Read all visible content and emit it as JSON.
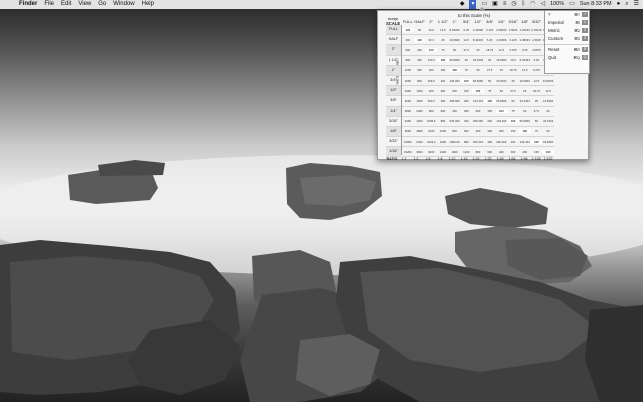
{
  "menubar": {
    "apple": "",
    "items": [
      "Finder",
      "File",
      "Edit",
      "View",
      "Go",
      "Window",
      "Help"
    ],
    "battery": "100%",
    "clock": "Sun 8:33 PM"
  },
  "popover": {
    "title": "to this Scale (%)",
    "scale_small": "change",
    "scale_label": "SCALE",
    "y_axis_label": "from this Scale",
    "columns": [
      "FULL",
      "HALF",
      "2\"",
      "1 1/2\"",
      "1\"",
      "3/4\"",
      "1/2\"",
      "3/8\"",
      "1/4\"",
      "3/16\"",
      "1/8\"",
      "3/32\"",
      "1/16\""
    ],
    "rows": [
      {
        "label": "FULL",
        "cells": [
          "100",
          "50",
          "16.6",
          "12.5",
          "8.33333",
          "6.25",
          "4.16666",
          "3.125",
          "2.08333",
          "1.5625",
          "1.04166",
          "0.78125",
          "0.52083"
        ]
      },
      {
        "label": "HALF",
        "cells": [
          "200",
          "100",
          "33.3",
          "25",
          "16.6666",
          "12.5",
          "8.33333",
          "6.25",
          "4.16666",
          "3.125",
          "2.08333",
          "1.5625",
          "1.04166"
        ]
      },
      {
        "label": "2\"",
        "cells": [
          "600",
          "300",
          "100",
          "75",
          "50",
          "37.5",
          "25",
          "18.75",
          "12.5",
          "9.375",
          "6.25",
          "4.6875",
          "3.125"
        ]
      },
      {
        "label": "1 1/2\"",
        "cells": [
          "800",
          "400",
          "133.3",
          "100",
          "66.6666",
          "50",
          "33.3333",
          "25",
          "16.6666",
          "12.5",
          "8.33333",
          "6.25",
          "4.16666"
        ]
      },
      {
        "label": "1\"",
        "cells": [
          "1200",
          "600",
          "200",
          "150",
          "100",
          "75",
          "50",
          "37.5",
          "25",
          "18.75",
          "12.5",
          "9.375",
          "6.25"
        ]
      },
      {
        "label": "3/4\"",
        "cells": [
          "1600",
          "800",
          "266.6",
          "200",
          "133.333",
          "100",
          "66.6666",
          "50",
          "33.3333",
          "25",
          "16.6666",
          "12.5",
          "8.33333"
        ]
      },
      {
        "label": "1/2\"",
        "cells": [
          "2400",
          "1200",
          "400",
          "300",
          "200",
          "150",
          "100",
          "75",
          "50",
          "37.5",
          "25",
          "18.75",
          "12.5"
        ]
      },
      {
        "label": "3/8\"",
        "cells": [
          "3200",
          "1600",
          "533.3",
          "400",
          "266.666",
          "200",
          "133.333",
          "100",
          "66.6666",
          "50",
          "33.3333",
          "25",
          "16.6666"
        ]
      },
      {
        "label": "1/4\"",
        "cells": [
          "4800",
          "2400",
          "800",
          "600",
          "400",
          "300",
          "200",
          "150",
          "100",
          "75",
          "50",
          "37.5",
          "25"
        ]
      },
      {
        "label": "3/16\"",
        "cells": [
          "6400",
          "3200",
          "1066.6",
          "800",
          "533.333",
          "400",
          "266.666",
          "200",
          "133.333",
          "100",
          "66.6666",
          "50",
          "33.3333"
        ]
      },
      {
        "label": "1/8\"",
        "cells": [
          "9600",
          "4800",
          "1600",
          "1200",
          "800",
          "600",
          "400",
          "300",
          "200",
          "150",
          "100",
          "75",
          "50"
        ]
      },
      {
        "label": "3/32\"",
        "cells": [
          "12800",
          "6400",
          "2133.3",
          "1600",
          "1066.66",
          "800",
          "533.333",
          "400",
          "266.666",
          "200",
          "133.333",
          "100",
          "66.6666"
        ]
      },
      {
        "label": "1/16\"",
        "cells": [
          "19200",
          "9600",
          "3200",
          "2400",
          "1600",
          "1200",
          "800",
          "600",
          "400",
          "300",
          "200",
          "150",
          "100"
        ]
      }
    ],
    "ratio_label": "RATIO",
    "ratios": [
      "1:1",
      "1:2",
      "1:6",
      "1:8",
      "1:12",
      "1:16",
      "1:24",
      "1:32",
      "1:48",
      "1:64",
      "1:96",
      "1:128",
      "1:192"
    ],
    "menu": {
      "items": [
        {
          "label": "?",
          "shortcut": "⌘?",
          "check": "?"
        },
        {
          "label": "Imperial",
          "shortcut": "⌘I",
          "check": "1"
        },
        {
          "label": "Metric",
          "shortcut": "⌘2",
          "check": "2"
        },
        {
          "label": "Custom",
          "shortcut": "⌘3",
          "check": "3"
        },
        {
          "label": "Reset",
          "shortcut": "⌘R",
          "check": "R"
        },
        {
          "label": "Quit",
          "shortcut": "⌘Q",
          "check": "Q"
        }
      ]
    }
  }
}
